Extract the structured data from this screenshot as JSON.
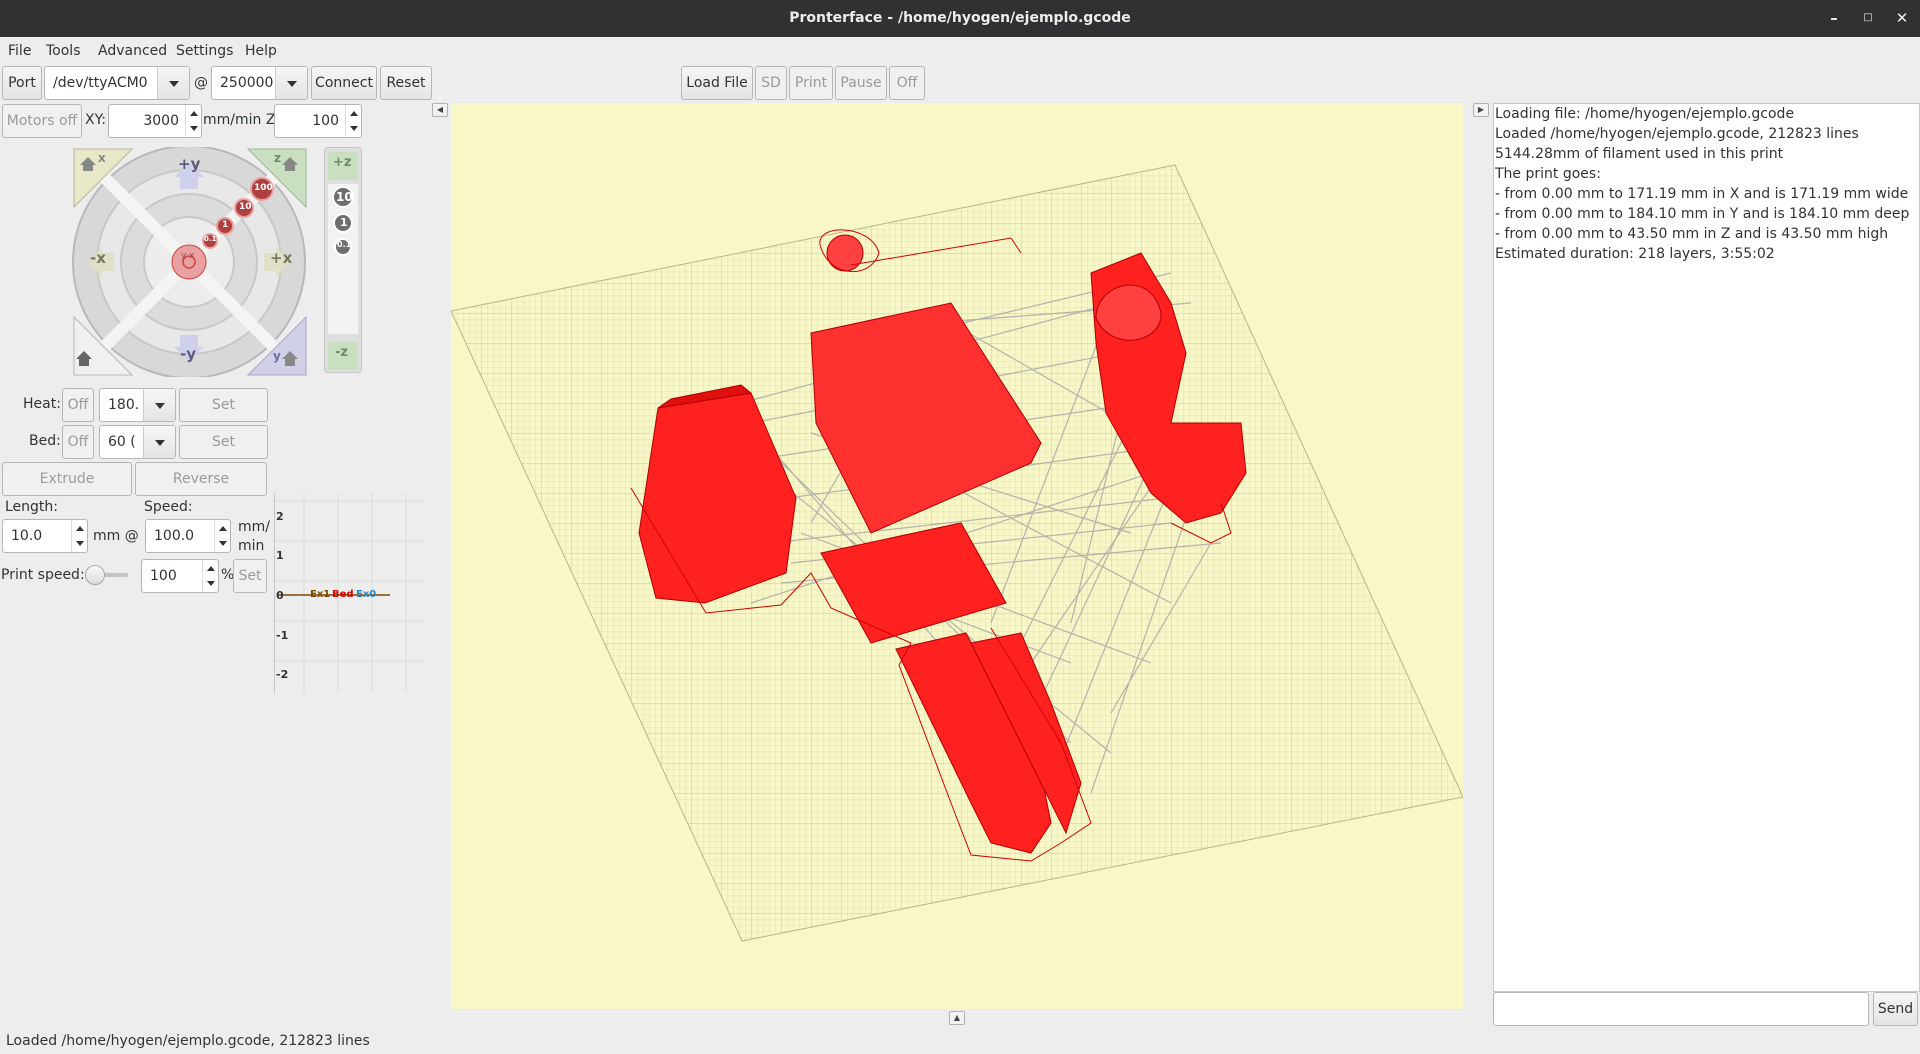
{
  "window": {
    "title": "Pronterface - /home/hyogen/ejemplo.gcode"
  },
  "menu": [
    "File",
    "Tools",
    "Advanced",
    "Settings",
    "Help"
  ],
  "toolbar": {
    "port_label": "Port",
    "port_value": "/dev/ttyACM0",
    "at_label": "@",
    "baud_value": "250000",
    "connect_label": "Connect",
    "reset_label": "Reset",
    "load_file_label": "Load File",
    "sd_label": "SD",
    "print_label": "Print",
    "pause_label": "Pause",
    "off_label": "Off"
  },
  "motion": {
    "motors_off_label": "Motors off",
    "xy_label": "XY:",
    "xy_value": "3000",
    "mmmin_z_label": "mm/min Z:",
    "z_value": "100",
    "jog": {
      "plus_y": "+y",
      "minus_y": "-y",
      "plus_x": "+x",
      "minus_x": "-x",
      "home_x": "x",
      "home_z": "z",
      "home_y": "y",
      "steps": [
        "100",
        "10",
        "1",
        "0.1"
      ],
      "center": "y x"
    },
    "zjog": {
      "plus_z": "+z",
      "minus_z": "-z",
      "steps": [
        "10",
        "1",
        "0.1"
      ]
    }
  },
  "temperature": {
    "heat_label": "Heat:",
    "heat_off_label": "Off",
    "heat_value": "180.",
    "heat_set_label": "Set",
    "bed_label": "Bed:",
    "bed_off_label": "Off",
    "bed_value": "60 (",
    "bed_set_label": "Set"
  },
  "extrusion": {
    "extrude_label": "Extrude",
    "reverse_label": "Reverse",
    "length_label": "Length:",
    "length_value": "10.0",
    "mm_at_label": "mm @",
    "speed_label": "Speed:",
    "speed_value": "100.0",
    "speed_unit_1": "mm/",
    "speed_unit_2": "min",
    "print_speed_label": "Print speed:",
    "print_speed_value": "100",
    "print_speed_fraction": 0.12,
    "percent_label": "%",
    "print_speed_set_label": "Set"
  },
  "temp_graph": {
    "y_ticks": [
      "2",
      "1",
      "0",
      "-1",
      "-2"
    ],
    "legend": [
      {
        "name": "Ex1",
        "color": "#7a4a00"
      },
      {
        "name": "Bed",
        "color": "#e00000"
      },
      {
        "name": "Ex0",
        "color": "#2a86c8"
      }
    ]
  },
  "log": [
    "Loading file: /home/hyogen/ejemplo.gcode",
    "Loaded /home/hyogen/ejemplo.gcode, 212823 lines",
    "5144.28mm of filament used in this print",
    "The print goes:",
    "- from 0.00 mm to 171.19 mm in X and is 171.19 mm wide",
    "- from 0.00 mm to 184.10 mm in Y and is 184.10 mm deep",
    "- from 0.00 mm to 43.50 mm in Z and is 43.50 mm high",
    "Estimated duration: 218 layers, 3:55:02"
  ],
  "send_label": "Send",
  "status": "Loaded /home/hyogen/ejemplo.gcode, 212823 lines",
  "colors": {
    "viewport_bg": "#f8f7c7",
    "print_red": "#ff2020",
    "travel_gray": "#a0a0a0"
  }
}
